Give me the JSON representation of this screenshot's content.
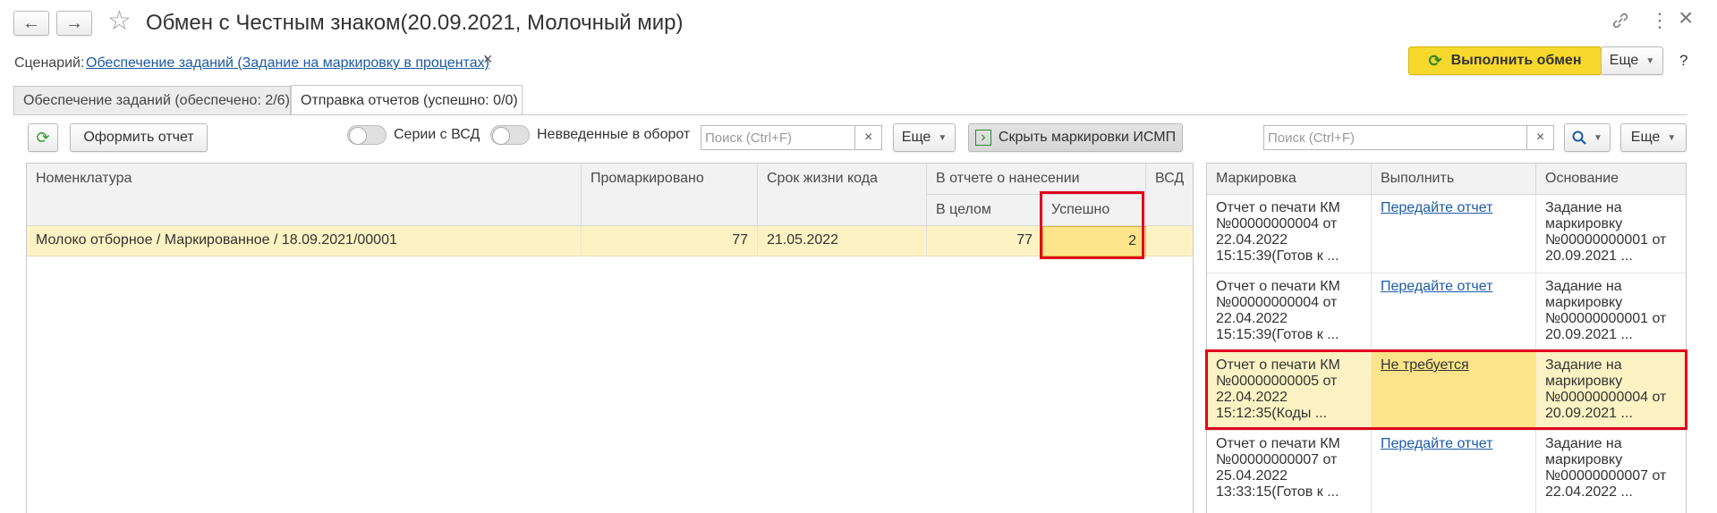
{
  "window": {
    "title": "Обмен с Честным знаком(20.09.2021, Молочный мир)",
    "back_icon": "←",
    "forward_icon": "→",
    "star_icon": "☆",
    "link_icon": "🔗",
    "more_icon": "⋮",
    "close_icon": "×"
  },
  "scenario": {
    "label": "Сценарий:",
    "value": "Обеспечение заданий (Задание на маркировку в процентах)",
    "clear_icon": "×"
  },
  "header_actions": {
    "exchange_label": "Выполнить обмен",
    "exchange_icon": "⟳",
    "more_label": "Еще",
    "help_label": "?"
  },
  "tabs": [
    {
      "label": "Обеспечение заданий (обеспечено: 2/6)"
    },
    {
      "label": "Отправка отчетов (успешно: 0/0)"
    }
  ],
  "left_toolbar": {
    "refresh_icon": "⟳",
    "make_report_label": "Оформить отчет",
    "toggle_vsd_label": "Серии с ВСД",
    "toggle_not_entered_label": "Невведенные в оборот",
    "search_placeholder": "Поиск (Ctrl+F)",
    "search_clear": "×",
    "more_label": "Еще",
    "hide_ismp_label": "Скрыть маркировки ИСМП",
    "hide_ismp_icon": "›"
  },
  "left_table": {
    "headers": {
      "nomenclature": "Номенклатура",
      "marked": "Промаркировано",
      "code_life": "Срок жизни кода",
      "report_group": "В отчете о нанесении",
      "total": "В целом",
      "success": "Успешно",
      "vsd": "ВСД"
    },
    "rows": [
      {
        "nomenclature": "Молоко отборное / Маркированное / 18.09.2021/00001",
        "marked": "77",
        "code_life": "21.05.2022",
        "total": "77",
        "success": "2"
      }
    ]
  },
  "right_toolbar": {
    "search_placeholder": "Поиск (Ctrl+F)",
    "search_clear": "×",
    "search_icon": "⚲",
    "more_label": "Еще"
  },
  "right_table": {
    "headers": {
      "marking": "Маркировка",
      "action": "Выполнить",
      "basis": "Основание"
    },
    "rows": [
      {
        "marking": "Отчет о печати КМ №00000000004 от 22.04.2022 15:15:39(Готов к ...",
        "action": "Передайте отчет",
        "basis": "Задание на маркировку №00000000001 от 20.09.2021 ..."
      },
      {
        "marking": "Отчет о печати КМ №00000000004 от 22.04.2022 15:15:39(Готов к ...",
        "action": "Передайте отчет",
        "basis": "Задание на маркировку №00000000001 от 20.09.2021 ..."
      },
      {
        "marking": "Отчет о печати КМ №00000000005 от 22.04.2022 15:12:35(Коды ...",
        "action": "Не требуется",
        "basis": "Задание на маркировку №00000000004 от 20.09.2021 ..."
      },
      {
        "marking": "Отчет о печати КМ №00000000007 от 25.04.2022 13:33:15(Готов к ...",
        "action": "Передайте отчет",
        "basis": "Задание на маркировку №00000000007 от 22.04.2022 ..."
      }
    ]
  },
  "colors": {
    "accent_yellow": "#f7d82d",
    "row_highlight": "#fdf2c4",
    "cell_highlight": "#fbe48a",
    "link": "#1c5aa8",
    "red_frame": "#e0001b"
  }
}
